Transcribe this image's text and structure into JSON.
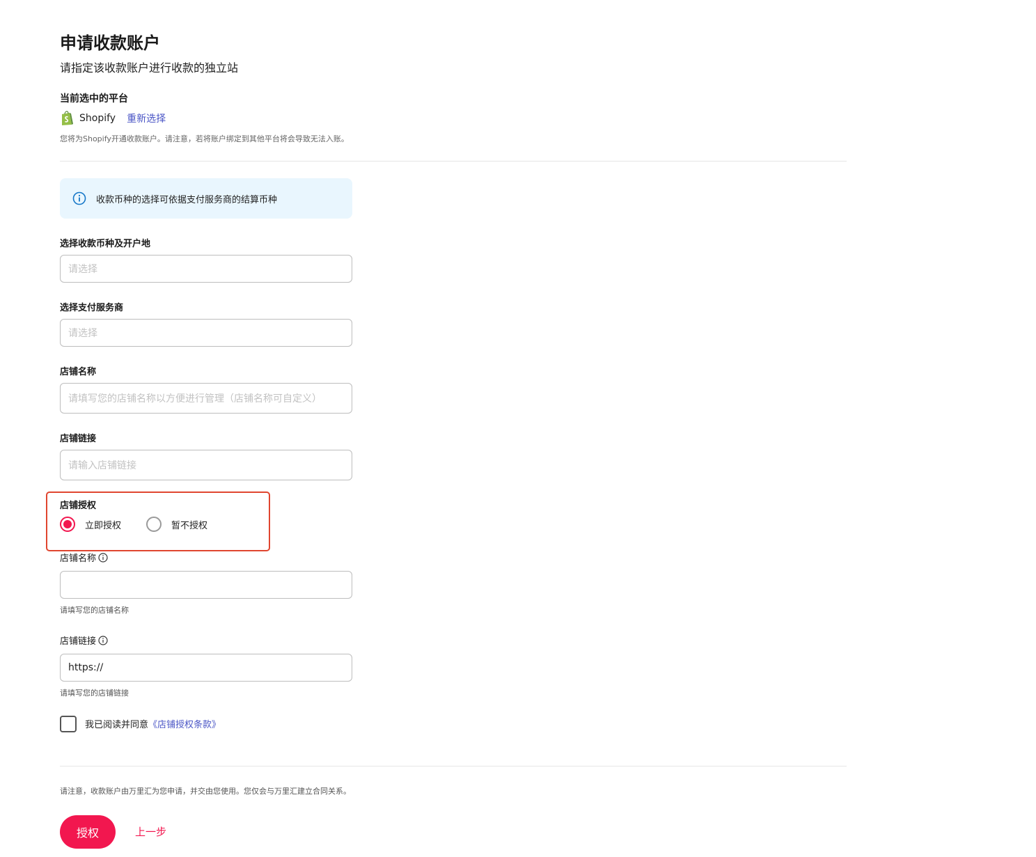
{
  "page": {
    "title": "申请收款账户",
    "subtitle": "请指定该收款账户进行收款的独立站"
  },
  "platform": {
    "label": "当前选中的平台",
    "name": "Shopify",
    "reselect": "重新选择",
    "note": "您将为Shopify开通收款账户。请注意，若将账户绑定到其他平台将会导致无法入账。"
  },
  "info_banner": {
    "text": "收款币种的选择可依据支付服务商的结算币种"
  },
  "fields": {
    "currency": {
      "label": "选择收款币种及开户地",
      "placeholder": "请选择"
    },
    "provider": {
      "label": "选择支付服务商",
      "placeholder": "请选择"
    },
    "store_name": {
      "label": "店铺名称",
      "placeholder": "请填写您的店铺名称以方便进行管理（店铺名称可自定义）"
    },
    "store_link": {
      "label": "店铺链接",
      "placeholder": "请输入店铺链接"
    }
  },
  "authorization": {
    "label": "店铺授权",
    "options": [
      {
        "label": "立即授权",
        "selected": true
      },
      {
        "label": "暂不授权",
        "selected": false
      }
    ]
  },
  "auth_fields": {
    "store_name": {
      "label": "店铺名称",
      "value": "",
      "help": "请填写您的店铺名称"
    },
    "store_link": {
      "label": "店铺链接",
      "value": "https://",
      "help": "请填写您的店铺链接"
    }
  },
  "agreement": {
    "text": "我已阅读并同意",
    "link": "《店铺授权条款》",
    "checked": false
  },
  "footer": {
    "note": "请注意，收款账户由万里汇为您申请，并交由您使用。您仅会与万里汇建立合同关系。",
    "primary_button": "授权",
    "back_link": "上一步"
  },
  "colors": {
    "accent": "#f2174f",
    "link": "#4b56c6",
    "info_bg": "#e9f6fe",
    "highlight_border": "#e0452f"
  }
}
